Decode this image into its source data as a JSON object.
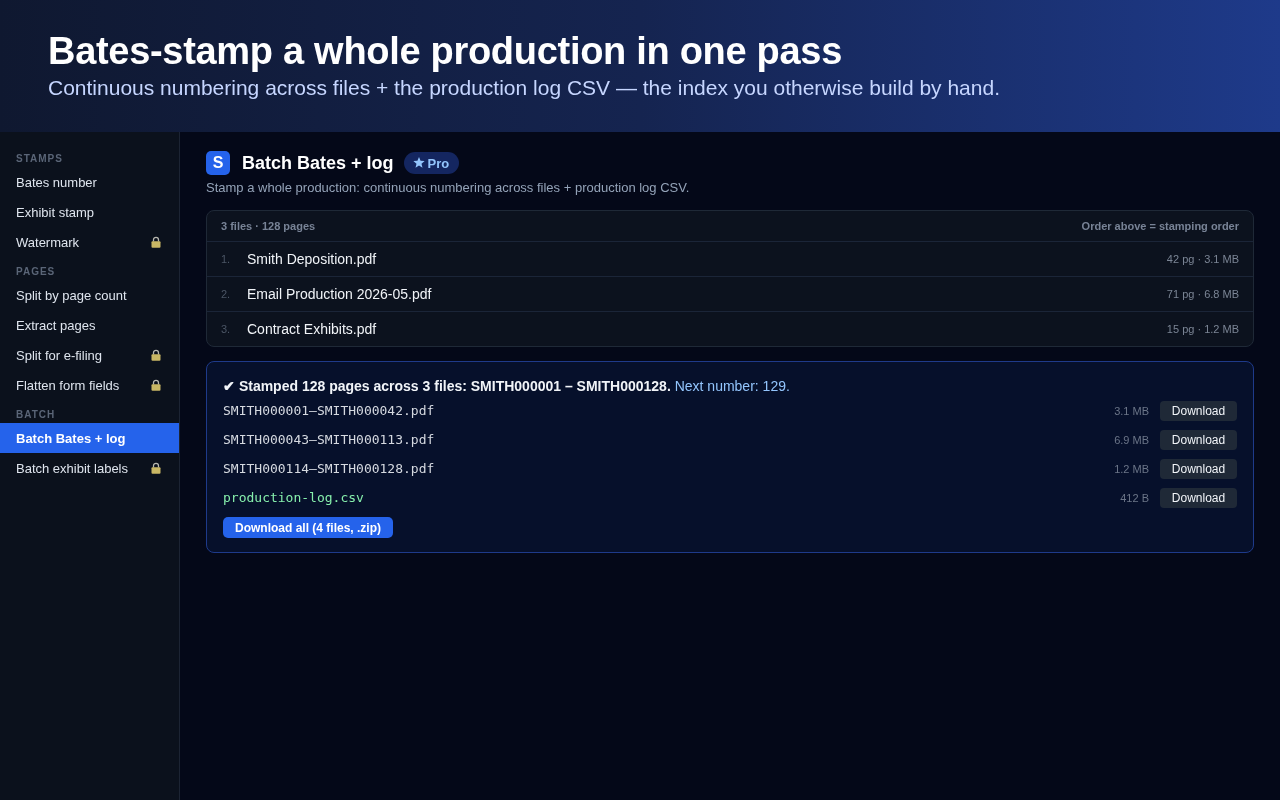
{
  "hero": {
    "title": "Bates-stamp a whole production in one pass",
    "subtitle": "Continuous numbering across files + the production log CSV — the index you otherwise build by hand."
  },
  "sidebar": {
    "sections": [
      {
        "heading": "STAMPS",
        "items": [
          {
            "label": "Bates number",
            "selected": false,
            "locked": false
          },
          {
            "label": "Exhibit stamp",
            "selected": false,
            "locked": false
          },
          {
            "label": "Watermark",
            "selected": false,
            "locked": true
          }
        ]
      },
      {
        "heading": "PAGES",
        "items": [
          {
            "label": "Split by page count",
            "selected": false,
            "locked": false
          },
          {
            "label": "Extract pages",
            "selected": false,
            "locked": false
          },
          {
            "label": "Split for e-filing",
            "selected": false,
            "locked": true
          },
          {
            "label": "Flatten form fields",
            "selected": false,
            "locked": true
          }
        ]
      },
      {
        "heading": "BATCH",
        "items": [
          {
            "label": "Batch Bates + log",
            "selected": true,
            "locked": false
          },
          {
            "label": "Batch exhibit labels",
            "selected": false,
            "locked": true
          }
        ]
      }
    ]
  },
  "tool": {
    "logo_letter": "S",
    "title": "Batch Bates + log",
    "badge": "Pro",
    "description": "Stamp a whole production: continuous numbering across files + production log CSV."
  },
  "files": {
    "summary": "3 files · 128 pages",
    "note": "Order above = stamping order",
    "rows": [
      {
        "index": "1.",
        "name": "Smith Deposition.pdf",
        "meta": "42 pg · 3.1 MB"
      },
      {
        "index": "2.",
        "name": "Email Production 2026-05.pdf",
        "meta": "71 pg · 6.8 MB"
      },
      {
        "index": "3.",
        "name": "Contract Exhibits.pdf",
        "meta": "15 pg · 1.2 MB"
      }
    ]
  },
  "result": {
    "summary": "**✔ Stamped 128 pages across 3 files: SMITH000001 – SMITH000128.** Next number: 129.",
    "outputs": [
      {
        "kind": "pdf",
        "name": "SMITH000001–SMITH000042.pdf",
        "size": "3.1 MB",
        "button": "Download"
      },
      {
        "kind": "pdf",
        "name": "SMITH000043–SMITH000113.pdf",
        "size": "6.9 MB",
        "button": "Download"
      },
      {
        "kind": "pdf",
        "name": "SMITH000114–SMITH000128.pdf",
        "size": "1.2 MB",
        "button": "Download"
      },
      {
        "kind": "csv",
        "name": "production-log.csv",
        "size": "412 B",
        "button": "Download"
      }
    ],
    "download_all": "Download all (4 files, .zip)"
  }
}
